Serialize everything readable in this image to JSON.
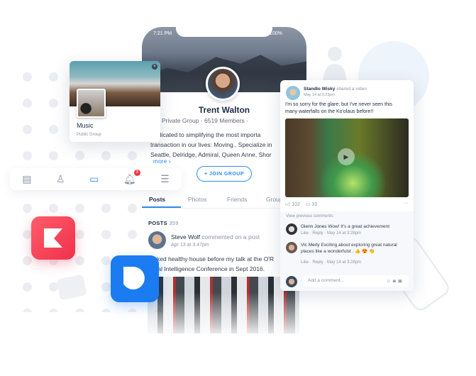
{
  "phone": {
    "time": "7:21 PM",
    "battery": "100%",
    "name": "Trent Walton",
    "info": "Private Group  ·  6519 Members  ·",
    "description": [
      "Dedicated to simplifying the most importa",
      "transaction in our lives: Moving., Specialize in",
      "Seattle, Delridge, Admiral, Queen Anne, Shor"
    ],
    "more": "more ›",
    "join": "+ JOIN GROUP",
    "tabs": [
      "Posts",
      "Photos",
      "Friends",
      "Groups"
    ],
    "posts_label": "POSTS",
    "posts_count": "359",
    "post": {
      "author": "Steve Wolf",
      "action": "commented on a post",
      "time": "Apr 13 at 3:47pm",
      "text": [
        "ecked healthy house before my talk at the O'R",
        "ficial Intelligence Conference in Sept 2016."
      ]
    }
  },
  "music": {
    "title": "Music",
    "subtitle": "Public Group",
    "close": "×"
  },
  "nav": {
    "badge": "3"
  },
  "feed": {
    "author": "Standlo Wisky",
    "action": "shared a video",
    "time": "May 14 at 3:23pm",
    "text": [
      "I'm so sorry for the glare, but I've never seen this",
      "many waterfalls on the Ko'olaus before!!"
    ],
    "likes": "102",
    "comments": "33",
    "more": "···",
    "view_previous": "View previous comments",
    "comment_list": [
      {
        "author": "Glenn Jones",
        "text": "Wow! It's a great achievement",
        "meta": "Like · Reply · May 14 at 3:28pm"
      },
      {
        "author": "Vic Merly",
        "text": "Exciting about exploring great natural",
        "text2": "places like a wonderfulst . 👍 😍 👏",
        "meta": "Like · Reply · May 14 at 3:28pm"
      }
    ],
    "add_comment_placeholder": "Add a comment..."
  },
  "colors": {
    "accent": "#2d8cf0",
    "badge": "#f0353f",
    "pink_app": "#f0304a",
    "blue_app": "#1b7cf2"
  }
}
